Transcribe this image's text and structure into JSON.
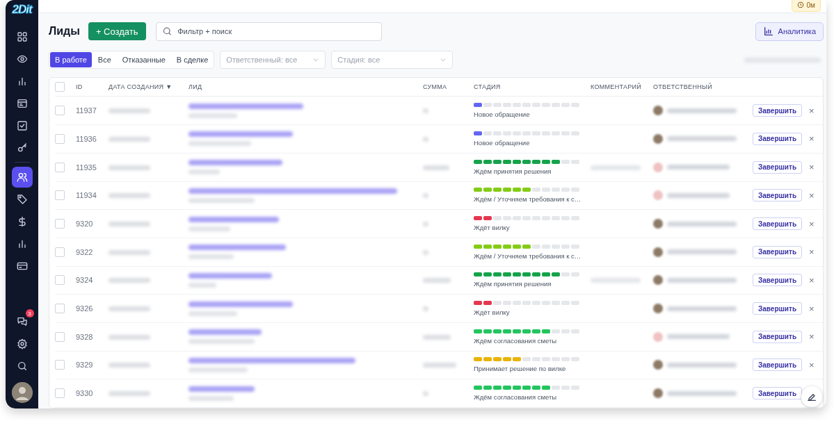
{
  "logo": "2Dit",
  "sidebar": {
    "items": [
      {
        "selected": false
      },
      {
        "selected": false
      },
      {
        "selected": false
      },
      {
        "selected": false
      },
      {
        "selected": false
      },
      {
        "selected": false
      },
      {
        "selected": true
      },
      {
        "selected": false
      },
      {
        "selected": false
      },
      {
        "selected": false
      },
      {
        "selected": false
      }
    ],
    "chat_badge": "3"
  },
  "topbar": {
    "timer": "0м"
  },
  "page": {
    "title": "Лиды",
    "create_button": "+ Создать",
    "search": {
      "placeholder": "Фильтр + поиск"
    },
    "analytics_button": "Аналитика"
  },
  "tabs": [
    {
      "label": "В работе",
      "selected": true
    },
    {
      "label": "Все",
      "selected": false
    },
    {
      "label": "Отказанные",
      "selected": false
    },
    {
      "label": "В сделке",
      "selected": false
    }
  ],
  "filters": [
    {
      "placeholder": "Ответственный: все"
    },
    {
      "placeholder": "Стадия: все"
    }
  ],
  "table": {
    "columns": [
      "ID",
      "ДАТА СОЗДАНИЯ",
      "ЛИД",
      "СУММА",
      "СТАДИЯ",
      "КОММЕНТАРИЙ",
      "ОТВЕТСТВЕННЫЙ"
    ],
    "sort_mark": "▼",
    "header_checked": false,
    "rows": [
      {
        "id": "11937",
        "checked": false,
        "stage": "Новое обращение",
        "level": 0.09,
        "color": "#6366f1",
        "action": "Завершить",
        "dismiss": "×"
      },
      {
        "id": "11936",
        "checked": false,
        "stage": "Новое обращение",
        "level": 0.09,
        "color": "#6366f1",
        "action": "Завершить",
        "dismiss": "×"
      },
      {
        "id": "11935",
        "checked": false,
        "stage": "Ждём принятия решения",
        "level": 0.82,
        "color": "#16a34a",
        "action": "Завершить",
        "dismiss": "×"
      },
      {
        "id": "11934",
        "checked": false,
        "stage": "Ждём / Уточняем требования к с…",
        "level": 0.55,
        "color": "#84cc16",
        "action": "Завершить",
        "dismiss": "×"
      },
      {
        "id": "9320",
        "checked": false,
        "stage": "Ждёт вилку",
        "level": 0.18,
        "color": "#e5384f",
        "action": "Завершить",
        "dismiss": "×"
      },
      {
        "id": "9322",
        "checked": false,
        "stage": "Ждём / Уточняем требования к с…",
        "level": 0.55,
        "color": "#84cc16",
        "action": "Завершить",
        "dismiss": "×"
      },
      {
        "id": "9324",
        "checked": false,
        "stage": "Ждём принятия решения",
        "level": 0.82,
        "color": "#16a34a",
        "action": "Завершить",
        "dismiss": "×"
      },
      {
        "id": "9326",
        "checked": false,
        "stage": "Ждёт вилку",
        "level": 0.18,
        "color": "#e5384f",
        "action": "Завершить",
        "dismiss": "×"
      },
      {
        "id": "9328",
        "checked": false,
        "stage": "Ждём согласования сметы",
        "level": 0.73,
        "color": "#22c55e",
        "action": "Завершить",
        "dismiss": "×"
      },
      {
        "id": "9329",
        "checked": false,
        "stage": "Принимает решение по вилке",
        "level": 0.45,
        "color": "#eab308",
        "action": "Завершить",
        "dismiss": "×"
      },
      {
        "id": "9330",
        "checked": false,
        "stage": "Ждём согласования сметы",
        "level": 0.73,
        "color": "#22c55e",
        "action": "Завершить"
      }
    ]
  }
}
